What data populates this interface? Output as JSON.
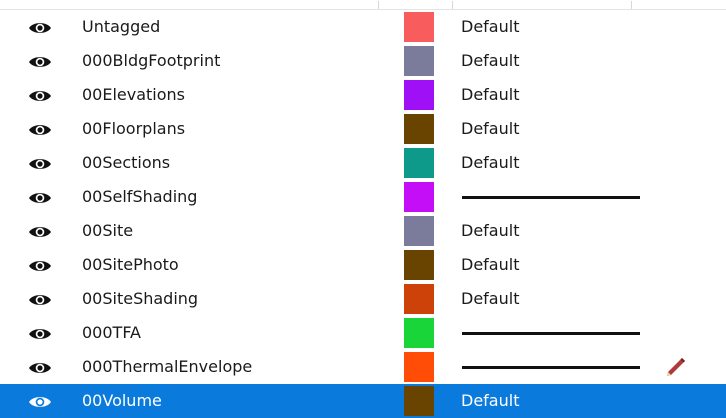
{
  "layers": [
    {
      "name": "Untagged",
      "visible": true,
      "color": "#f95c5c",
      "style": "Default",
      "style_kind": "text",
      "selected": false,
      "editing": false
    },
    {
      "name": "000BldgFootprint",
      "visible": true,
      "color": "#7b7b9b",
      "style": "Default",
      "style_kind": "text",
      "selected": false,
      "editing": false
    },
    {
      "name": "00Elevations",
      "visible": true,
      "color": "#a010f7",
      "style": "Default",
      "style_kind": "text",
      "selected": false,
      "editing": false
    },
    {
      "name": "00Floorplans",
      "visible": true,
      "color": "#684400",
      "style": "Default",
      "style_kind": "text",
      "selected": false,
      "editing": false
    },
    {
      "name": "00Sections",
      "visible": true,
      "color": "#0e9a8a",
      "style": "Default",
      "style_kind": "text",
      "selected": false,
      "editing": false
    },
    {
      "name": "00SelfShading",
      "visible": true,
      "color": "#c30ef7",
      "style": "",
      "style_kind": "line",
      "selected": false,
      "editing": false
    },
    {
      "name": "00Site",
      "visible": true,
      "color": "#7b7b9b",
      "style": "Default",
      "style_kind": "text",
      "selected": false,
      "editing": false
    },
    {
      "name": "00SitePhoto",
      "visible": true,
      "color": "#684400",
      "style": "Default",
      "style_kind": "text",
      "selected": false,
      "editing": false
    },
    {
      "name": "00SiteShading",
      "visible": true,
      "color": "#cc4209",
      "style": "Default",
      "style_kind": "text",
      "selected": false,
      "editing": false
    },
    {
      "name": "000TFA",
      "visible": true,
      "color": "#1ad53a",
      "style": "",
      "style_kind": "line",
      "selected": false,
      "editing": false
    },
    {
      "name": "000ThermalEnvelope",
      "visible": true,
      "color": "#ff4c07",
      "style": "",
      "style_kind": "line",
      "selected": false,
      "editing": true
    },
    {
      "name": "00Volume",
      "visible": true,
      "color": "#684400",
      "style": "Default",
      "style_kind": "text",
      "selected": true,
      "editing": false
    }
  ],
  "icons": {
    "visibility": "eye-icon",
    "edit": "pencil-icon"
  },
  "colors": {
    "selection": "#0a7bdc",
    "text": "#1a1a1a",
    "selected_text": "#ffffff"
  }
}
